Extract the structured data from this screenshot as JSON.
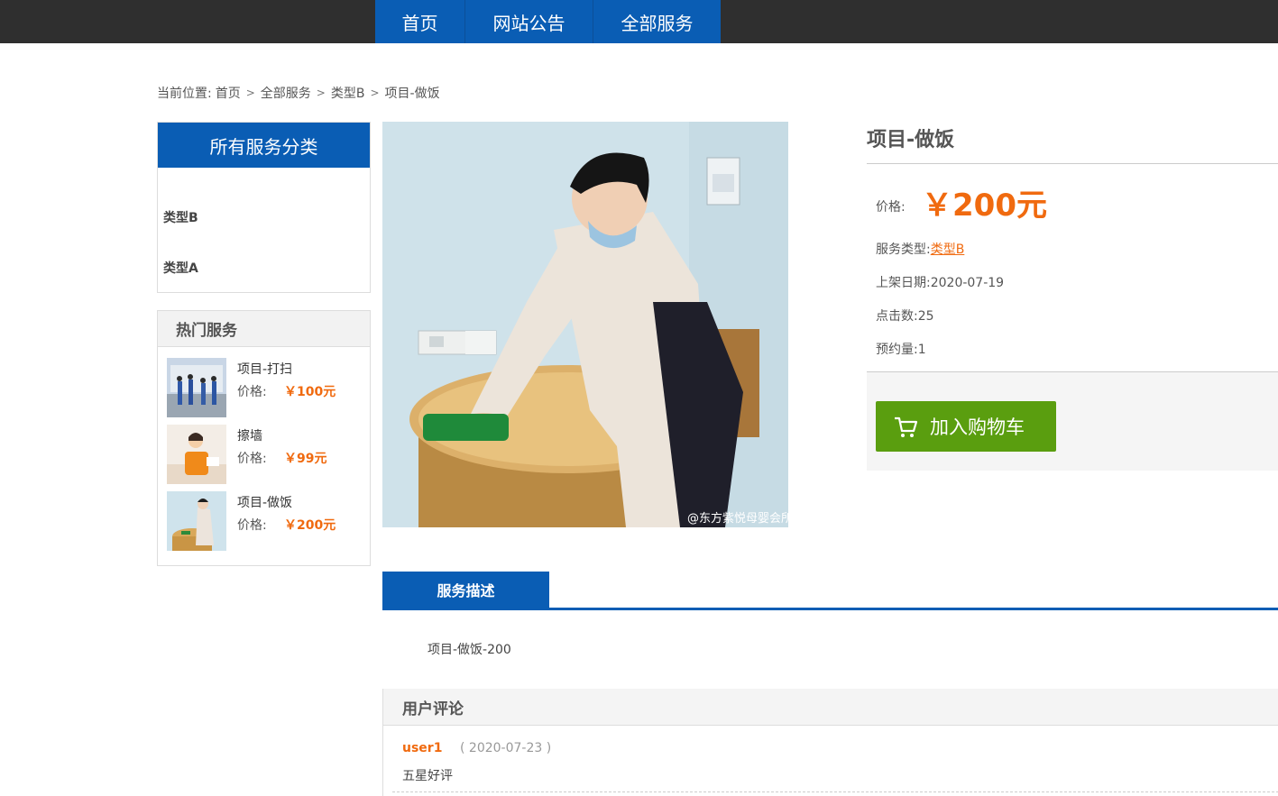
{
  "nav": {
    "items": [
      {
        "label": "首页"
      },
      {
        "label": "网站公告"
      },
      {
        "label": "全部服务"
      }
    ]
  },
  "breadcrumb": {
    "prefix": "当前位置:",
    "items": [
      "首页",
      "全部服务",
      "类型B",
      "项目-做饭"
    ]
  },
  "sidebar": {
    "category_title": "所有服务分类",
    "categories": [
      {
        "label": "类型B"
      },
      {
        "label": "类型A"
      }
    ],
    "hot_title": "热门服务",
    "hot_items": [
      {
        "name": "项目-打扫",
        "price_label": "价格:",
        "price": "￥100元"
      },
      {
        "name": "擦墙",
        "price_label": "价格:",
        "price": "￥99元"
      },
      {
        "name": "项目-做饭",
        "price_label": "价格:",
        "price": "￥200元"
      }
    ]
  },
  "product": {
    "title": "项目-做饭",
    "price_label": "价格:",
    "price": "￥200元",
    "type_label": "服务类型:",
    "type_value": "类型B",
    "date_label": "上架日期:",
    "date_value": "2020-07-19",
    "clicks_label": "点击数:",
    "clicks_value": "25",
    "bookings_label": "预约量:",
    "bookings_value": "1",
    "cart_button": "加入购物车",
    "image_watermark": "@东方紫悦母婴会所"
  },
  "description": {
    "tab_label": "服务描述",
    "text": "项目-做饭-200"
  },
  "comments": {
    "title": "用户评论",
    "items": [
      {
        "user": "user1",
        "date": "( 2020-07-23 )",
        "text": "五星好评"
      }
    ]
  },
  "colors": {
    "primary": "#0a5db4",
    "accent": "#f06a0f",
    "cart": "#5a9e0f",
    "topbar": "#2f2f2f"
  }
}
